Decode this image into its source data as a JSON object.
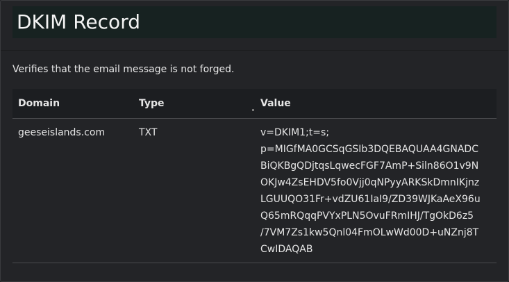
{
  "title": "DKIM Record",
  "description": "Verifies that the email message is not forged.",
  "table": {
    "headers": [
      "Domain",
      "Type",
      "Value"
    ],
    "rows": [
      {
        "domain": "geeseislands.com",
        "type": "TXT",
        "value_lines": [
          "v=DKIM1;t=s;",
          "p=MIGfMA0GCSqGSIb3DQEBAQUAA4GNADC",
          "BiQKBgQDjtqsLqwecFGF7AmP+Siln86O1v9N",
          "OKJw4ZsEHDV5fo0Vjj0qNPyyARKSkDmnIKjnz",
          "LGUUQO31Fr+vdZU61IaI9/ZD39WJKaAeX96u",
          "Q65mRQqqPVYxPLN5OvuFRmIHJ/TgOkD6z5",
          "/7VM7Zs1kw5Qnl04FmOLwWd00D+uNZnj8T",
          "CwIDAQAB"
        ]
      }
    ]
  }
}
